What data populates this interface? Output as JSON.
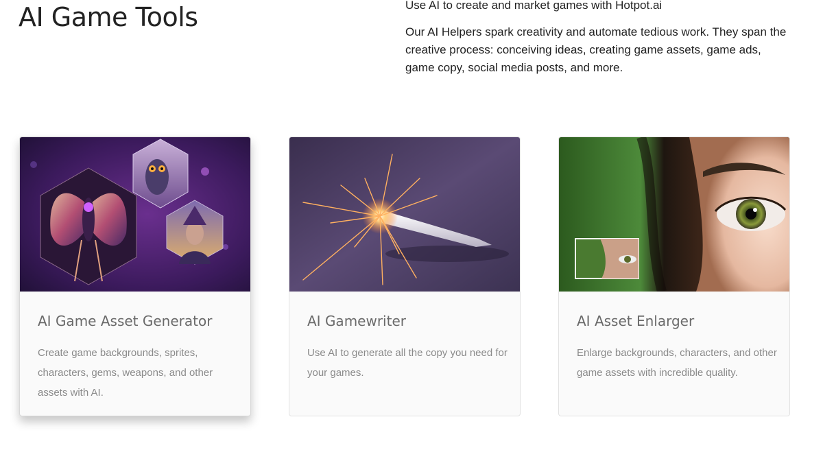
{
  "header": {
    "title": "AI Game Tools",
    "lead": "Use AI to create and market games with Hotpot.ai",
    "body": "Our AI Helpers spark creativity and automate tedious work. They span the creative process: conceiving ideas, creating game assets, game ads, game copy, social media posts, and more."
  },
  "cards": [
    {
      "title": "AI Game Asset Generator",
      "description": "Create game backgrounds, sprites, characters, gems, weapons, and other assets with AI.",
      "image": "fantasy-hexagon-art"
    },
    {
      "title": "AI Gamewriter",
      "description": "Use AI to generate all the copy you need for your games.",
      "image": "sparkling-pen"
    },
    {
      "title": "AI Asset Enlarger",
      "description": "Enlarge backgrounds, characters, and other game assets with incredible quality.",
      "image": "eye-closeup"
    }
  ],
  "colors": {
    "title": "#222222",
    "card_title": "#6a6a6a",
    "card_text": "#8a8a8a",
    "card_bg": "#fafafa"
  }
}
